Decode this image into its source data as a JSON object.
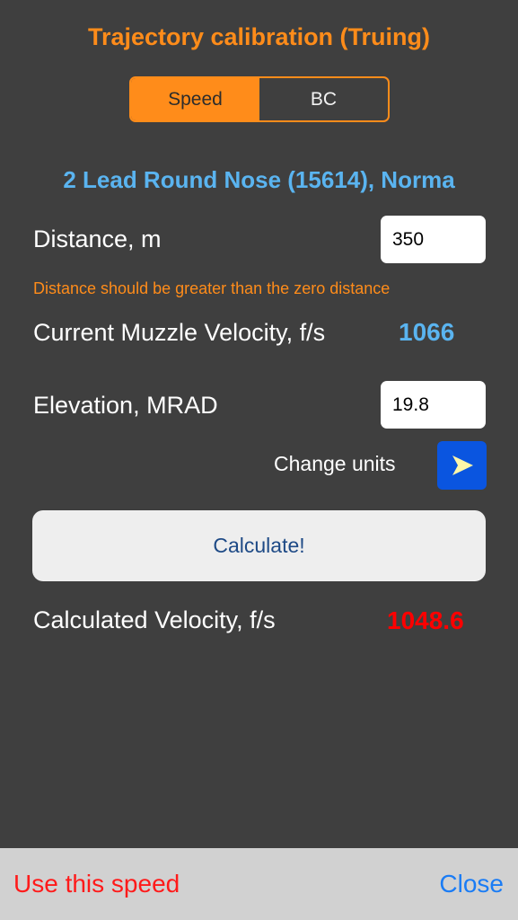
{
  "title": "Trajectory calibration (Truing)",
  "segments": [
    {
      "label": "Speed",
      "selected": true
    },
    {
      "label": "BC",
      "selected": false
    }
  ],
  "ammo_name": "2 Lead Round Nose (15614), Norma",
  "distance": {
    "label": "Distance, m",
    "value": "350"
  },
  "warning": "Distance should be greater than the zero distance",
  "muzzle_velocity": {
    "label": "Current Muzzle Velocity, f/s",
    "value": "1066"
  },
  "elevation": {
    "label": "Elevation, MRAD",
    "value": "19.8"
  },
  "change_units": {
    "label": "Change units",
    "icon": "play-arrow-icon"
  },
  "calculate_label": "Calculate!",
  "calculated_velocity": {
    "label": "Calculated Velocity, f/s",
    "value": "1048.6"
  },
  "toolbar": {
    "use_speed_label": "Use this speed",
    "close_label": "Close"
  },
  "colors": {
    "background": "#3f3f3f",
    "accent_orange": "#ff8c1a",
    "value_blue": "#5ab4f0",
    "result_red": "#ff0000",
    "units_button_blue": "#0a55e0"
  }
}
